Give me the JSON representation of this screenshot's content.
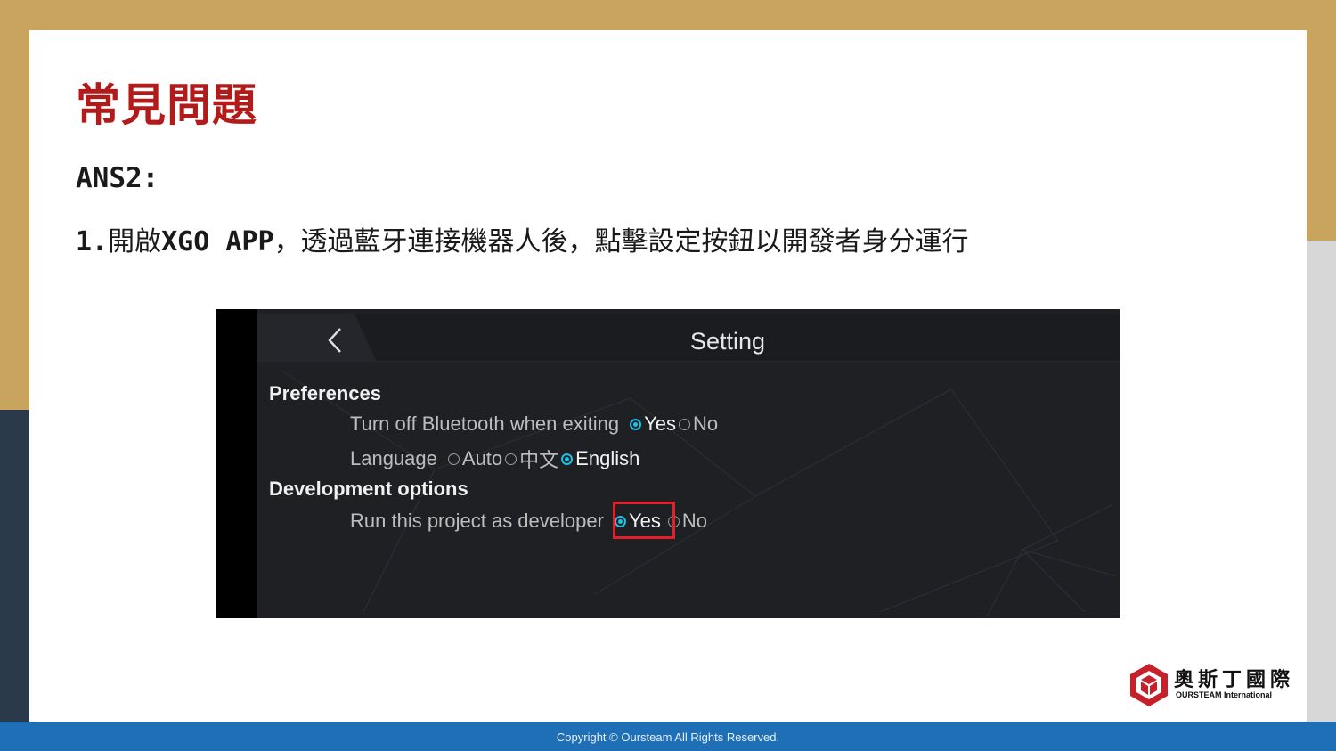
{
  "slide": {
    "title": "常見問題",
    "answer_label": "ANS2:",
    "step_number": "1.",
    "step_text_pre": "開啟",
    "step_app": "XGO APP",
    "step_text_post": "，透過藍牙連接機器人後，點擊設定按鈕以開發者身分運行"
  },
  "screenshot": {
    "header_title": "Setting",
    "back_icon": "chevron-left-icon",
    "sections": {
      "preferences": "Preferences",
      "development": "Development options"
    },
    "bluetooth_row": {
      "label": "Turn off Bluetooth when exiting",
      "options": [
        "Yes",
        "No"
      ],
      "selected": "Yes"
    },
    "language_row": {
      "label": "Language",
      "options": [
        "Auto",
        "中文",
        "English"
      ],
      "selected": "English"
    },
    "developer_row": {
      "label": "Run this project as developer",
      "options": [
        "Yes",
        "No"
      ],
      "selected": "Yes"
    },
    "accent_color": "#19c3e6",
    "highlight_color": "#e0202a"
  },
  "logo": {
    "name_cn": "奧斯丁國際",
    "name_en": "OURSTEAM International",
    "icon": "cube-logo-icon"
  },
  "footer": {
    "copyright": "Copyright © Oursteam All Rights Reserved."
  },
  "colors": {
    "title_red": "#b31b1b",
    "gold": "#c9a45f",
    "footer_blue": "#1f6fb6"
  }
}
